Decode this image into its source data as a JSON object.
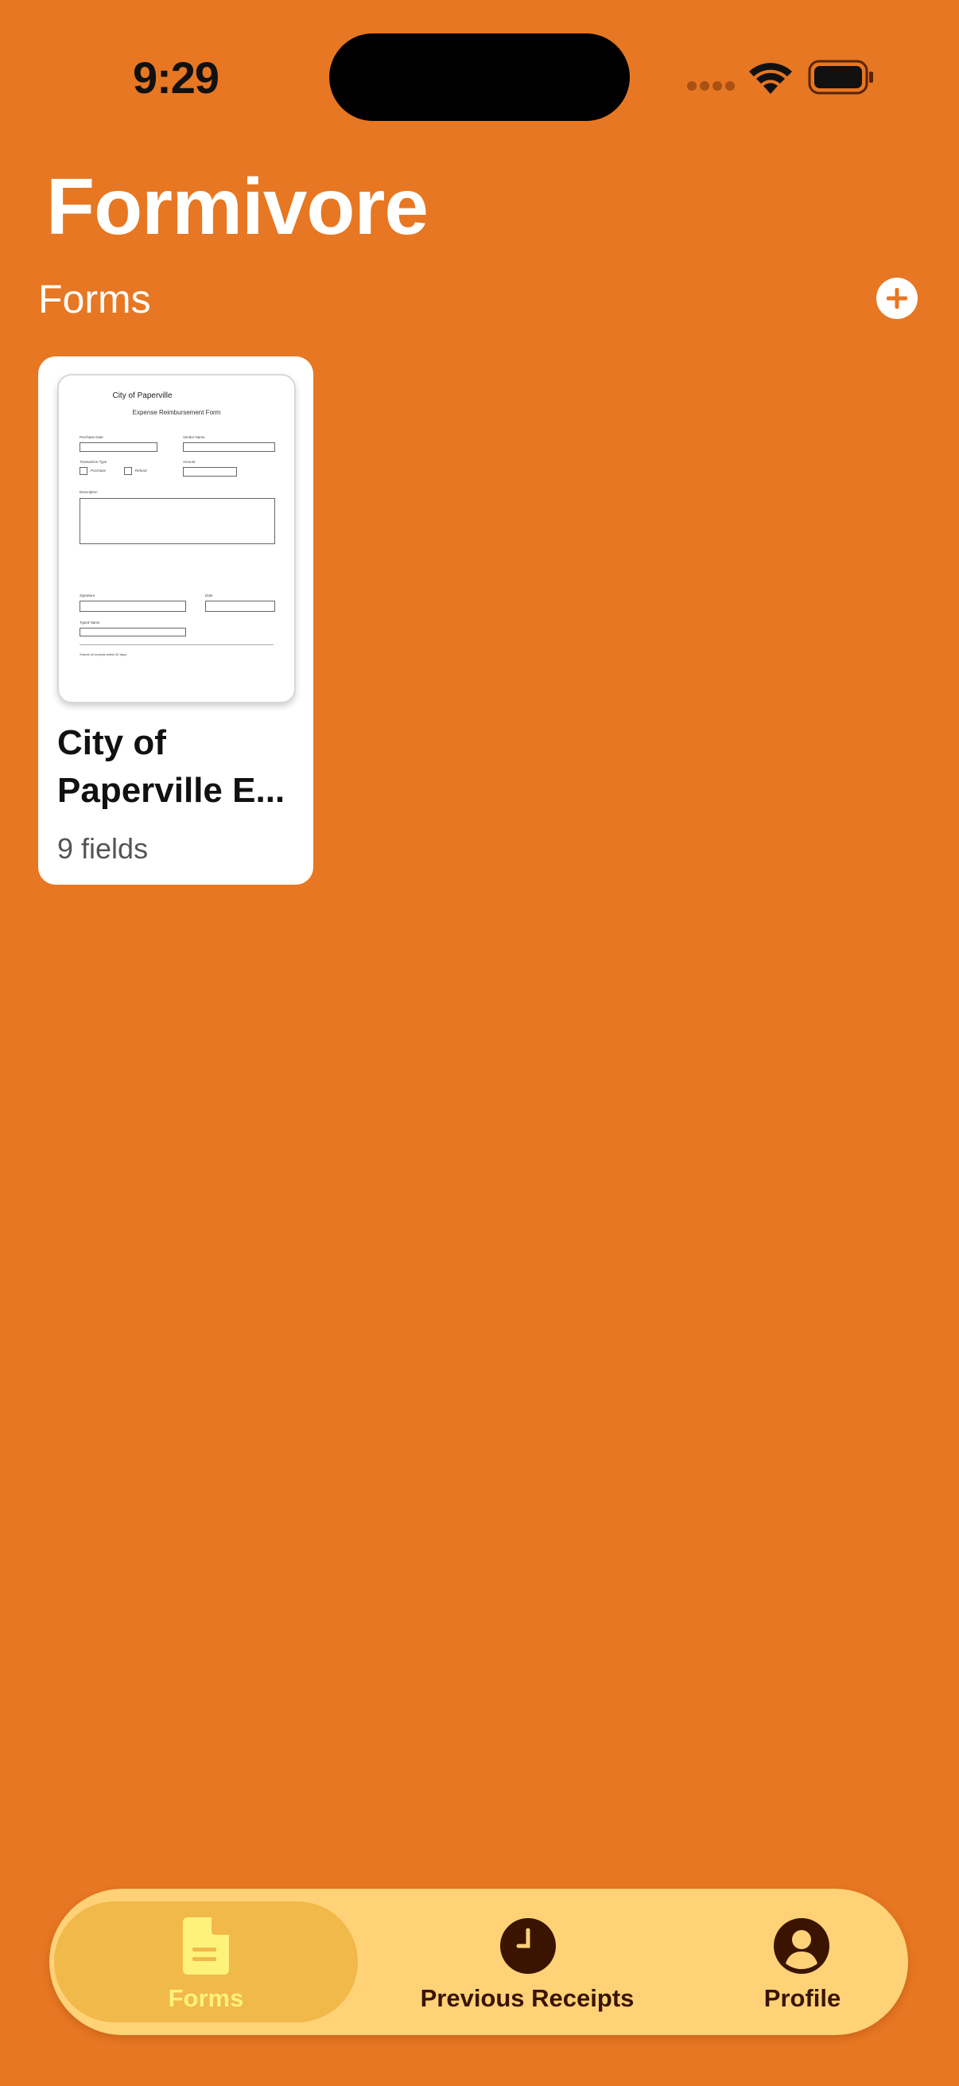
{
  "status_bar": {
    "time": "9:29"
  },
  "header": {
    "app_title": "Formivore",
    "section_title": "Forms"
  },
  "forms": [
    {
      "title": "City of Paperville E...",
      "fields_label": "9 fields",
      "preview": {
        "doc_title": "City of Paperville",
        "doc_subtitle": "Expense Reimbursement Form"
      }
    }
  ],
  "tab_bar": {
    "tabs": [
      {
        "label": "Forms",
        "icon": "document-icon",
        "selected": true
      },
      {
        "label": "Previous Receipts",
        "icon": "clock-icon",
        "selected": false
      },
      {
        "label": "Profile",
        "icon": "person-icon",
        "selected": false
      }
    ]
  },
  "colors": {
    "background": "#E77722",
    "tab_bar": "#FFD277",
    "tab_selected_bg": "#F1B84A",
    "tab_selected_fg": "#FFF27A",
    "tab_fg": "#3A1400",
    "card": "#FFFFFF"
  }
}
